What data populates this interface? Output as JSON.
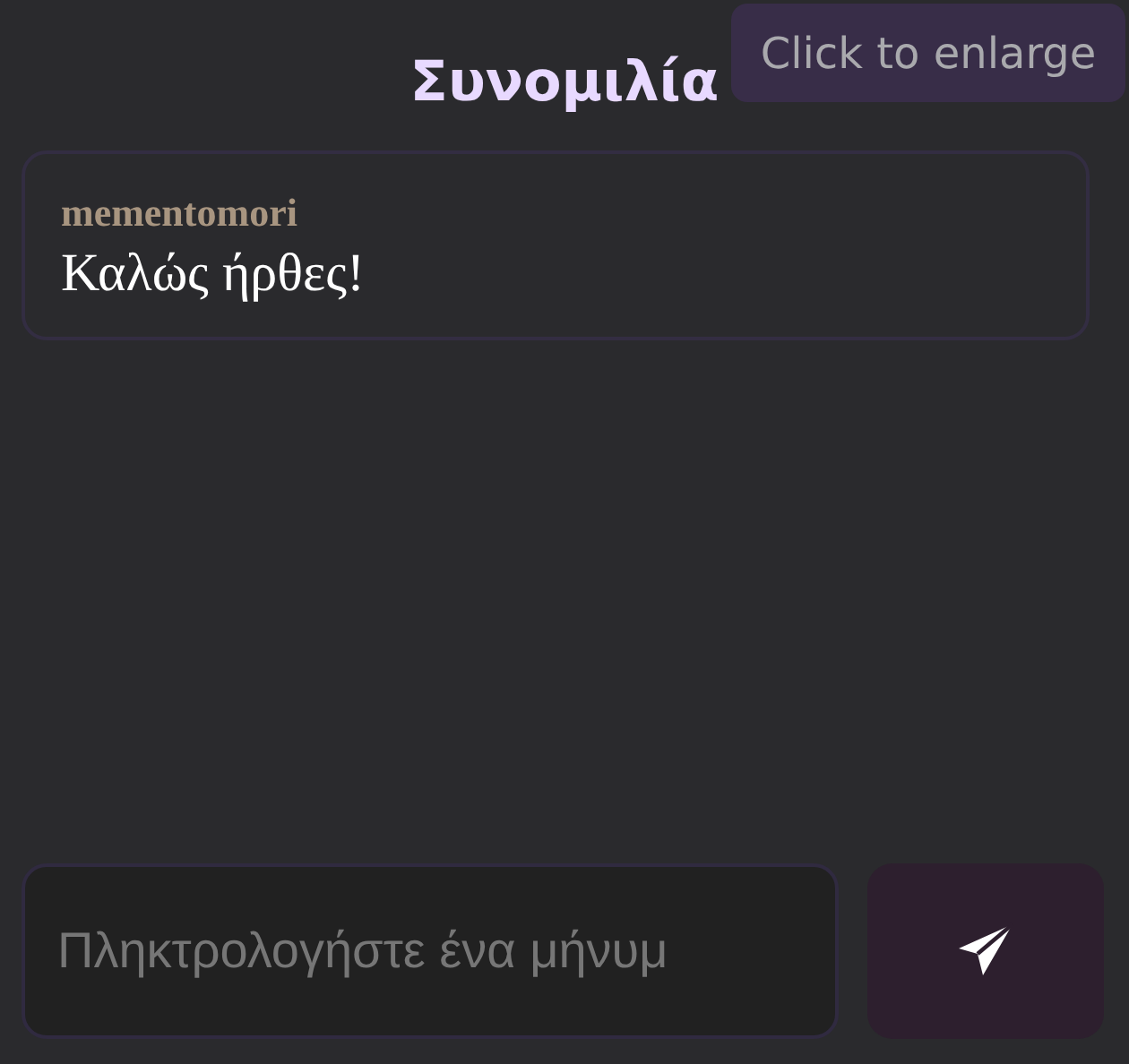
{
  "title": "Συνομιλία",
  "tooltip": "Click to enlarge",
  "messages": [
    {
      "author": "mementomori",
      "text": "Καλώς ήρθες!"
    }
  ],
  "composer": {
    "placeholder": "Πληκτρολογήστε ένα μήνυμ"
  }
}
